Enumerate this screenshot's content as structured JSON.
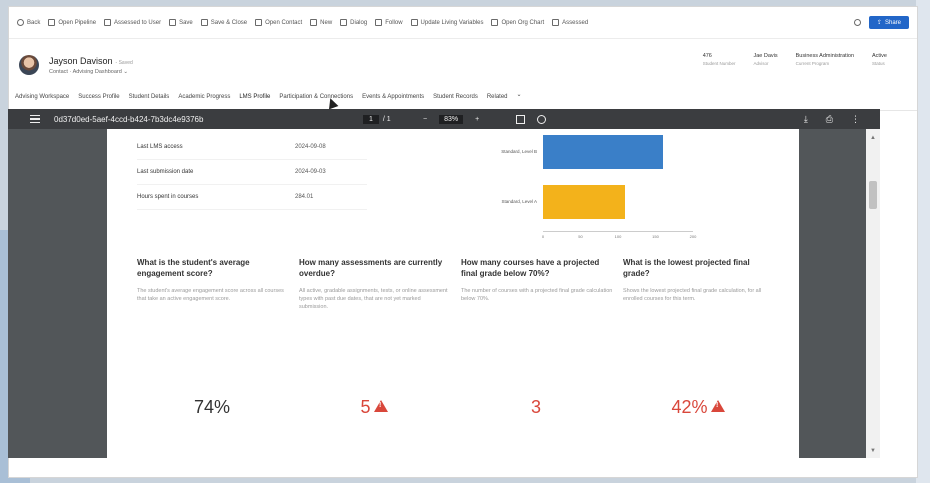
{
  "commandbar": {
    "items": [
      {
        "label": "Back",
        "icon": "back-arrow-icon"
      },
      {
        "label": "Open Pipeline",
        "icon": "pipeline-icon"
      },
      {
        "label": "Assessed to User",
        "icon": "assign-icon"
      },
      {
        "label": "Save",
        "icon": "save-icon"
      },
      {
        "label": "Save & Close",
        "icon": "save-close-icon"
      },
      {
        "label": "Open Contact",
        "icon": "contact-icon"
      },
      {
        "label": "New",
        "icon": "plus-icon"
      },
      {
        "label": "Dialog",
        "icon": "dialog-icon"
      },
      {
        "label": "Follow",
        "icon": "follow-icon"
      },
      {
        "label": "Update Living Variables",
        "icon": "update-icon"
      },
      {
        "label": "Open Org Chart",
        "icon": "org-chart-icon"
      },
      {
        "label": "Assessed",
        "icon": "assessed-icon"
      }
    ],
    "share_label": "Share"
  },
  "record": {
    "name": "Jayson Davison",
    "saved": "- Saved",
    "type": "Contact",
    "form": "Advising Dashboard",
    "fields": [
      {
        "value": "476",
        "label": "Student Number"
      },
      {
        "value": "Jae Davis",
        "label": "Advisor"
      },
      {
        "value": "Business Administration",
        "label": "Current Program"
      },
      {
        "value": "Active",
        "label": "Status"
      }
    ]
  },
  "tabs": [
    "Advising Workspace",
    "Success Profile",
    "Student Details",
    "Academic Progress",
    "LMS Profile",
    "Participation & Connections",
    "Events & Appointments",
    "Student Records",
    "Related"
  ],
  "active_tab": "LMS Profile",
  "viewer": {
    "filename": "0d37d0ed-5aef-4ccd-b424-7b3dc4e9376b",
    "page_current": "1",
    "page_total": "/ 1",
    "zoom": "83%"
  },
  "stats": [
    {
      "label": "Last LMS access",
      "value": "2024-09-08"
    },
    {
      "label": "Last submission date",
      "value": "2024-09-03"
    },
    {
      "label": "Hours spent in courses",
      "value": "284.01"
    }
  ],
  "chart_data": {
    "type": "bar",
    "orientation": "horizontal",
    "categories": [
      "Standard, Level B",
      "Standard, Level A"
    ],
    "values": [
      160,
      109
    ],
    "colors": [
      "#3a7fc8",
      "#f3b21b"
    ],
    "xticks": [
      "0",
      "50",
      "100",
      "150",
      "200"
    ],
    "xlim": [
      0,
      200
    ]
  },
  "cards": [
    {
      "question": "What is the student's average engagement score?",
      "description": "The student's average engagement score across all courses that take an active engagement score.",
      "metric": "74%",
      "alert": false,
      "color": "#333333"
    },
    {
      "question": "How many assessments are currently overdue?",
      "description": "All active, gradable assignments, tests, or online assessment types with past due dates, that are not yet marked submission.",
      "metric": "5",
      "alert": true,
      "color": "#d9473b"
    },
    {
      "question": "How many courses have a projected final grade below 70%?",
      "description": "The number of courses with a projected final grade calculation below 70%.",
      "metric": "3",
      "alert": false,
      "color": "#d9473b"
    },
    {
      "question": "What is the lowest projected final grade?",
      "description": "Shows the lowest projected final grade calculation, for all enrolled courses for this term.",
      "metric": "42%",
      "alert": true,
      "color": "#d9473b"
    }
  ]
}
